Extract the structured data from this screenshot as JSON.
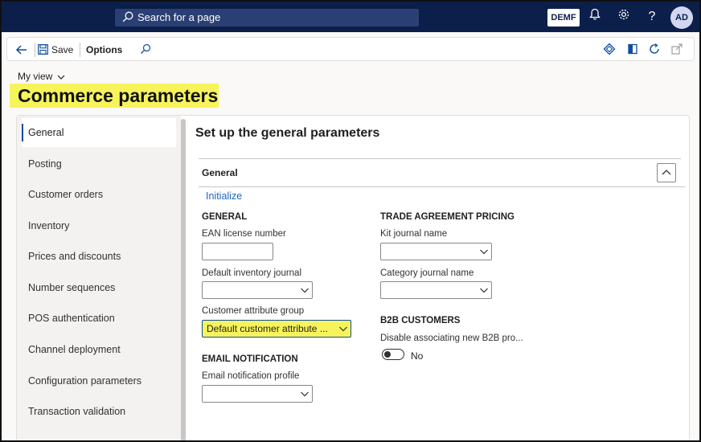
{
  "topbar": {
    "search_placeholder": "Search for a page",
    "company": "DEMF",
    "avatar_initials": "AD",
    "help_icon": "?",
    "icons": [
      "bell-icon",
      "gear-icon",
      "help-icon"
    ]
  },
  "actionpane": {
    "save_label": "Save",
    "options_label": "Options"
  },
  "page": {
    "view_label": "My view",
    "title": "Commerce parameters",
    "section_heading": "Set up the general parameters"
  },
  "nav": {
    "items": [
      {
        "label": "General"
      },
      {
        "label": "Posting"
      },
      {
        "label": "Customer orders"
      },
      {
        "label": "Inventory"
      },
      {
        "label": "Prices and discounts"
      },
      {
        "label": "Number sequences"
      },
      {
        "label": "POS authentication"
      },
      {
        "label": "Channel deployment"
      },
      {
        "label": "Configuration parameters"
      },
      {
        "label": "Transaction validation"
      }
    ]
  },
  "fasttab": {
    "title": "General",
    "initialize_label": "Initialize"
  },
  "left_col": {
    "general_heading": "GENERAL",
    "ean_label": "EAN license number",
    "ean_value": "",
    "default_inventory_journal_label": "Default inventory journal",
    "default_inventory_journal_value": "",
    "customer_attribute_group_label": "Customer attribute group",
    "customer_attribute_group_value": "Default customer attribute ...",
    "email_heading": "EMAIL NOTIFICATION",
    "email_profile_label": "Email notification profile",
    "email_profile_value": ""
  },
  "right_col": {
    "trade_heading": "TRADE AGREEMENT PRICING",
    "kit_journal_label": "Kit journal name",
    "kit_journal_value": "",
    "category_journal_label": "Category journal name",
    "category_journal_value": "",
    "b2b_heading": "B2B CUSTOMERS",
    "b2b_disable_label": "Disable associating new B2B pro...",
    "b2b_toggle_value": "No"
  },
  "colors": {
    "topbar": "#0c1f4a",
    "highlight": "#f7f35a",
    "accent": "#0f4ca3",
    "link": "#2266c0"
  }
}
